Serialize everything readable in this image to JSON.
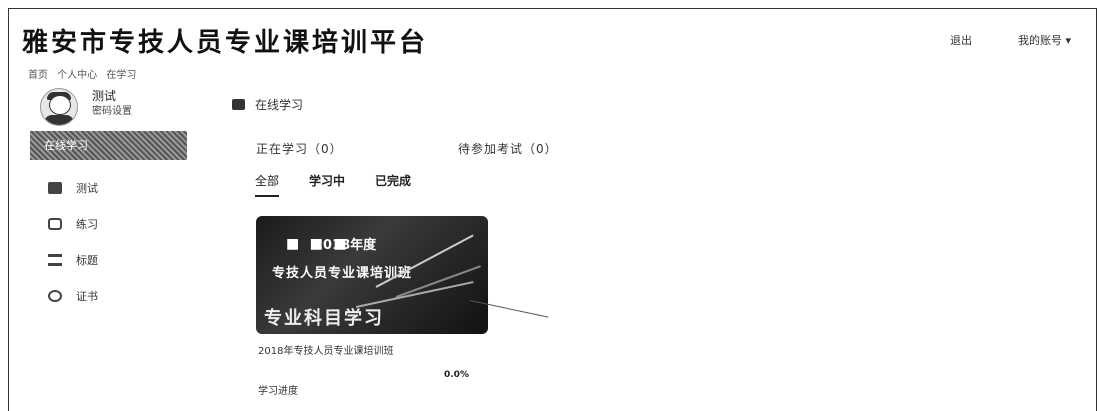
{
  "header": {
    "title": "雅安市专技人员专业课培训平台",
    "link_exit": "退出",
    "link_account": "我的账号",
    "account_arrow": "▾"
  },
  "breadcrumb": [
    "首页",
    "个人中心",
    "在学习"
  ],
  "profile": {
    "name": "测试",
    "sub": "密码设置"
  },
  "sidebar": {
    "active": "在线学习",
    "items": [
      {
        "label": "测试",
        "icon": "profile-icon"
      },
      {
        "label": "练习",
        "icon": "practice-icon"
      },
      {
        "label": "标题",
        "icon": "title-icon"
      },
      {
        "label": "证书",
        "icon": "certificate-icon"
      }
    ]
  },
  "main": {
    "section_title": "在线学习",
    "stat_learning": "正在学习（0）",
    "stat_exam": "待参加考试（0）",
    "tabs": [
      "全部",
      "学习中",
      "已完成"
    ],
    "active_tab": 0
  },
  "course": {
    "banner_year": "2018年度",
    "banner_title": "专技人员专业课培训班",
    "banner_big": "专业科目学习",
    "name": "2018年专技人员专业课培训班",
    "progress_label": "学习进度",
    "progress_value": "0.0%"
  }
}
